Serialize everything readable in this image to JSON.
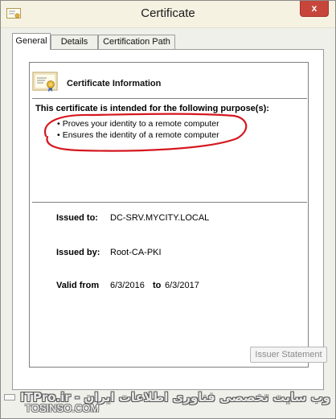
{
  "window": {
    "title": "Certificate",
    "close_label": "x"
  },
  "tabs": [
    {
      "label": "General"
    },
    {
      "label": "Details"
    },
    {
      "label": "Certification Path"
    }
  ],
  "info": {
    "title": "Certificate Information",
    "purpose_heading": "This certificate is intended for the following purpose(s):",
    "purposes": [
      "Proves your identity to a remote computer",
      "Ensures the identity of a remote computer"
    ]
  },
  "fields": {
    "issued_to_label": "Issued to:",
    "issued_to_value": "DC-SRV.MYCITY.LOCAL",
    "issued_by_label": "Issued by:",
    "issued_by_value": "Root-CA-PKI",
    "valid_from_label": "Valid from",
    "valid_from_value": "6/3/2016",
    "valid_to_label": "to",
    "valid_to_value": "6/3/2017"
  },
  "buttons": {
    "issuer_statement": "Issuer Statement"
  },
  "watermark": {
    "persian": "ITPro.ir - وب سایت تخصصی فناوری اطلاعات ایران",
    "english": "TOSINSO.COM"
  },
  "colors": {
    "close_button": "#c7463b",
    "annotation": "#d41820",
    "title_bar": "#f5f2e2"
  }
}
